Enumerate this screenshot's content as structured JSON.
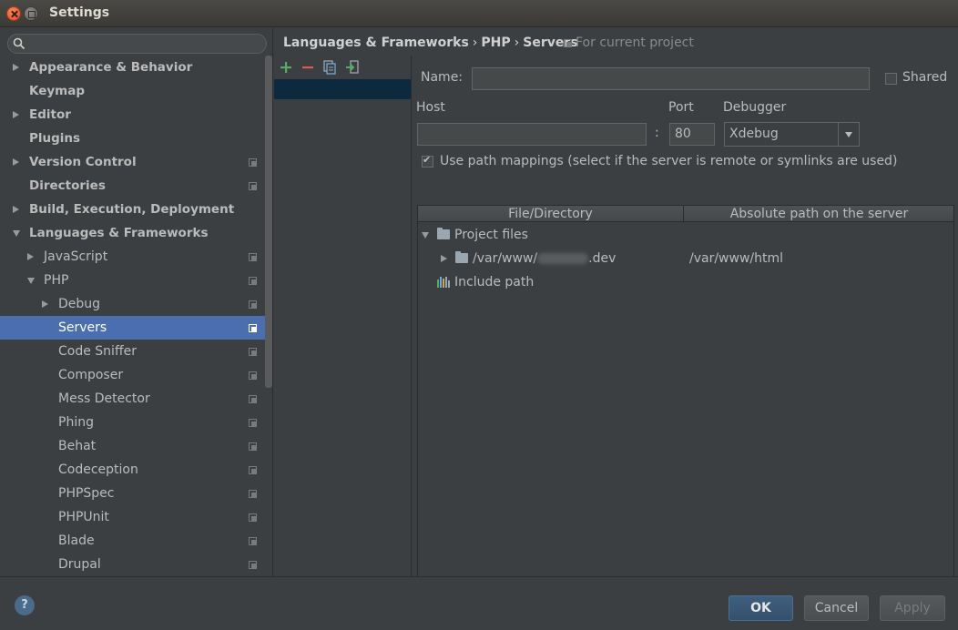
{
  "window": {
    "title": "Settings"
  },
  "search": {
    "placeholder": ""
  },
  "sidebar": {
    "items": [
      {
        "label": "Appearance & Behavior",
        "level": 0,
        "bold": true,
        "expander": "right",
        "project": false
      },
      {
        "label": "Keymap",
        "level": 0,
        "bold": true,
        "expander": "none",
        "project": false
      },
      {
        "label": "Editor",
        "level": 0,
        "bold": true,
        "expander": "right",
        "project": false
      },
      {
        "label": "Plugins",
        "level": 0,
        "bold": true,
        "expander": "none",
        "project": false
      },
      {
        "label": "Version Control",
        "level": 0,
        "bold": true,
        "expander": "right",
        "project": true
      },
      {
        "label": "Directories",
        "level": 0,
        "bold": true,
        "expander": "none",
        "project": true
      },
      {
        "label": "Build, Execution, Deployment",
        "level": 0,
        "bold": true,
        "expander": "right",
        "project": false
      },
      {
        "label": "Languages & Frameworks",
        "level": 0,
        "bold": true,
        "expander": "down",
        "project": false
      },
      {
        "label": "JavaScript",
        "level": 1,
        "bold": false,
        "expander": "right",
        "project": true
      },
      {
        "label": "PHP",
        "level": 1,
        "bold": false,
        "expander": "down",
        "project": true
      },
      {
        "label": "Debug",
        "level": 2,
        "bold": false,
        "expander": "right",
        "project": true
      },
      {
        "label": "Servers",
        "level": 2,
        "bold": false,
        "expander": "none",
        "project": true,
        "selected": true
      },
      {
        "label": "Code Sniffer",
        "level": 2,
        "bold": false,
        "expander": "none",
        "project": true
      },
      {
        "label": "Composer",
        "level": 2,
        "bold": false,
        "expander": "none",
        "project": true
      },
      {
        "label": "Mess Detector",
        "level": 2,
        "bold": false,
        "expander": "none",
        "project": true
      },
      {
        "label": "Phing",
        "level": 2,
        "bold": false,
        "expander": "none",
        "project": true
      },
      {
        "label": "Behat",
        "level": 2,
        "bold": false,
        "expander": "none",
        "project": true
      },
      {
        "label": "Codeception",
        "level": 2,
        "bold": false,
        "expander": "none",
        "project": true
      },
      {
        "label": "PHPSpec",
        "level": 2,
        "bold": false,
        "expander": "none",
        "project": true
      },
      {
        "label": "PHPUnit",
        "level": 2,
        "bold": false,
        "expander": "none",
        "project": true
      },
      {
        "label": "Blade",
        "level": 2,
        "bold": false,
        "expander": "none",
        "project": true
      },
      {
        "label": "Drupal",
        "level": 2,
        "bold": false,
        "expander": "none",
        "project": true
      }
    ]
  },
  "breadcrumb": {
    "parts": [
      "Languages & Frameworks",
      "PHP",
      "Servers"
    ],
    "separator": "›",
    "scope_note": "For current project"
  },
  "toolbar": {
    "add": "add-icon",
    "remove": "remove-icon",
    "copy": "copy-icon",
    "import": "import-icon"
  },
  "form": {
    "name_label": "Name:",
    "name_value": "",
    "shared_label": "Shared",
    "shared_checked": false,
    "host_label": "Host",
    "host_value": "",
    "colon": ":",
    "port_label": "Port",
    "port_value": "80",
    "debugger_label": "Debugger",
    "debugger_value": "Xdebug",
    "path_mappings_label": "Use path mappings (select if the server is remote or symlinks are used)",
    "path_mappings_checked": true
  },
  "mapping_table": {
    "headers": [
      "File/Directory",
      "Absolute path on the server"
    ],
    "project_files_label": "Project files",
    "row_path_prefix": "/var/www/",
    "row_path_suffix": ".dev",
    "row_server_path": "/var/www/html",
    "include_path_label": "Include path"
  },
  "footer": {
    "help": "?",
    "ok": "OK",
    "cancel": "Cancel",
    "apply": "Apply"
  },
  "colors": {
    "selection": "#4b6eaf",
    "list_selection": "#0d293e",
    "add_green": "#59a869",
    "remove_red": "#e05555",
    "background": "#3c3f41"
  }
}
